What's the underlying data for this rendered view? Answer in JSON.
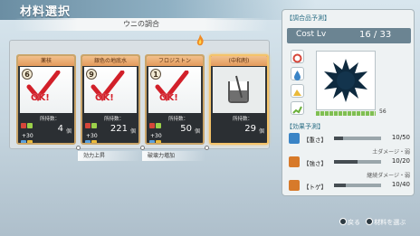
{
  "screen": {
    "title": "材料選択",
    "subtitle": "ウニの調合"
  },
  "cards": [
    {
      "name": "薬核",
      "level": "6",
      "ok_label": "OK!",
      "stock_label": "所持数：",
      "stock": "4",
      "unit": "個",
      "bonus": "+30",
      "selected": true
    },
    {
      "name": "銀色の地底水",
      "level": "9",
      "ok_label": "OK!",
      "stock_label": "所持数：",
      "stock": "221",
      "unit": "個",
      "bonus": "+30",
      "selected": true
    },
    {
      "name": "フロジストン",
      "level": "1",
      "ok_label": "OK!",
      "stock_label": "所持数：",
      "stock": "50",
      "unit": "個",
      "bonus": "+30",
      "selected": true
    },
    {
      "name": "(中和剤)",
      "stock_label": "所持数：",
      "stock": "29",
      "unit": "個",
      "selected": false
    }
  ],
  "bonuses": [
    "効力上昇",
    "破壊力増加"
  ],
  "panel": {
    "prediction_title": "【調合品予測】",
    "cost_label": "Cost Lv",
    "cost_value": "16 / 33",
    "gauge_value": "56",
    "effects_title": "【効果予測】",
    "effects": [
      {
        "name": "【重さ】",
        "value": "10/50",
        "level": 0.2,
        "sub": "土ダメージ・弱",
        "color": "#3a84c6"
      },
      {
        "name": "【強さ】",
        "value": "10/20",
        "level": 0.5,
        "sub": "継続ダメージ・弱",
        "color": "#d77a2a"
      },
      {
        "name": "【トゲ】",
        "value": "10/40",
        "level": 0.25,
        "sub": "",
        "color": "#d77a2a"
      }
    ]
  },
  "hints": {
    "back": "戻る",
    "choose": "材料を選ぶ"
  },
  "colors": {
    "accent": "#2c6f86",
    "ok": "#d2202a",
    "card_head": "#e39a5c"
  }
}
